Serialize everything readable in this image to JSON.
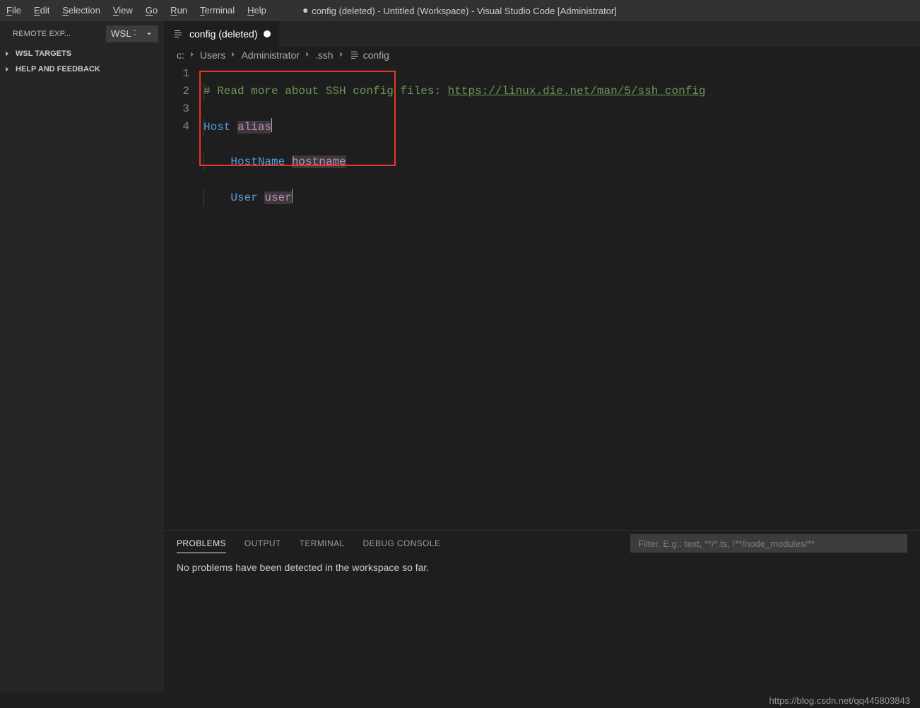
{
  "menubar": {
    "items": [
      {
        "label": "File",
        "mnemonic": 0
      },
      {
        "label": "Edit",
        "mnemonic": 0
      },
      {
        "label": "Selection",
        "mnemonic": 0
      },
      {
        "label": "View",
        "mnemonic": 0
      },
      {
        "label": "Go",
        "mnemonic": 0
      },
      {
        "label": "Run",
        "mnemonic": 0
      },
      {
        "label": "Terminal",
        "mnemonic": 0
      },
      {
        "label": "Help",
        "mnemonic": 0
      }
    ],
    "window_title": "config (deleted) - Untitled (Workspace) - Visual Studio Code [Administrator]"
  },
  "sidebar": {
    "title": "REMOTE EXP...",
    "dropdown_value": "WSL ˸",
    "sections": [
      {
        "label": "WSL TARGETS"
      },
      {
        "label": "HELP AND FEEDBACK"
      }
    ]
  },
  "tabs": [
    {
      "label": "config (deleted)",
      "dirty": true
    }
  ],
  "breadcrumbs": [
    "c:",
    "Users",
    "Administrator",
    ".ssh",
    "config"
  ],
  "editor": {
    "line_numbers": [
      "1",
      "2",
      "3",
      "4"
    ],
    "lines": {
      "l1_comment": "# Read more about SSH config files: ",
      "l1_link": "https://linux.die.net/man/5/ssh_config",
      "l2_key": "Host",
      "l2_ph": "alias",
      "l3_key": "HostName",
      "l3_ph": "hostname",
      "l4_key": "User",
      "l4_ph": "user"
    }
  },
  "panel": {
    "tabs": [
      {
        "label": "PROBLEMS",
        "active": true
      },
      {
        "label": "OUTPUT"
      },
      {
        "label": "TERMINAL"
      },
      {
        "label": "DEBUG CONSOLE"
      }
    ],
    "filter_placeholder": "Filter. E.g.: text, **/*.ts, !**/node_modules/**",
    "message": "No problems have been detected in the workspace so far."
  },
  "watermark": "https://blog.csdn.net/qq445803843"
}
